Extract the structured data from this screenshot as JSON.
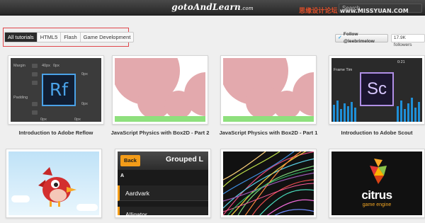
{
  "header": {
    "logo": "gotoAndLearn",
    "logo_suffix": ".com",
    "search_placeholder": "Search",
    "site_tag": "思缘设计论坛",
    "site_host": "www.MISSYUAN.COM"
  },
  "filters": {
    "tabs": [
      "All tutorials",
      "HTML5",
      "Flash",
      "Game Development"
    ],
    "active": "All tutorials"
  },
  "social": {
    "follow_label": "Follow @leebrimelow",
    "followers": "17.9K followers"
  },
  "cards": [
    {
      "title": "Introduction to Adobe Reflow",
      "icon_text": "Rf",
      "panel_labels": [
        "Margin",
        "Padding"
      ],
      "panel_values": [
        "40px",
        "0px",
        "0px",
        "0px",
        "0px",
        "0px"
      ]
    },
    {
      "title": "JavaScript Physics with Box2D - Part 2"
    },
    {
      "title": "JavaScript Physics with Box2D - Part 1"
    },
    {
      "title": "Introduction to Adobe Scout",
      "icon_text": "Sc",
      "frame_label": "Frame Tim",
      "time_label": "0:21"
    },
    {
      "title": ""
    },
    {
      "title": "",
      "back_label": "Back",
      "list_title": "Grouped L",
      "section_letter": "A",
      "rows": [
        "Aardvark",
        "Alligator"
      ]
    },
    {
      "title": ""
    },
    {
      "title": "",
      "brand": "citrus",
      "brand_sub": "game engine"
    }
  ],
  "colors": {
    "accent_orange": "#f39c19",
    "twitter_blue": "#41a9e1",
    "highlight_red": "#e0474c",
    "physics_pink": "#e3a9ad",
    "physics_green": "#8ee07d"
  },
  "icons": [
    "twitter-bird-icon",
    "adobe-reflow-icon",
    "adobe-scout-icon",
    "red-bird-icon",
    "citrus-logo-icon"
  ]
}
